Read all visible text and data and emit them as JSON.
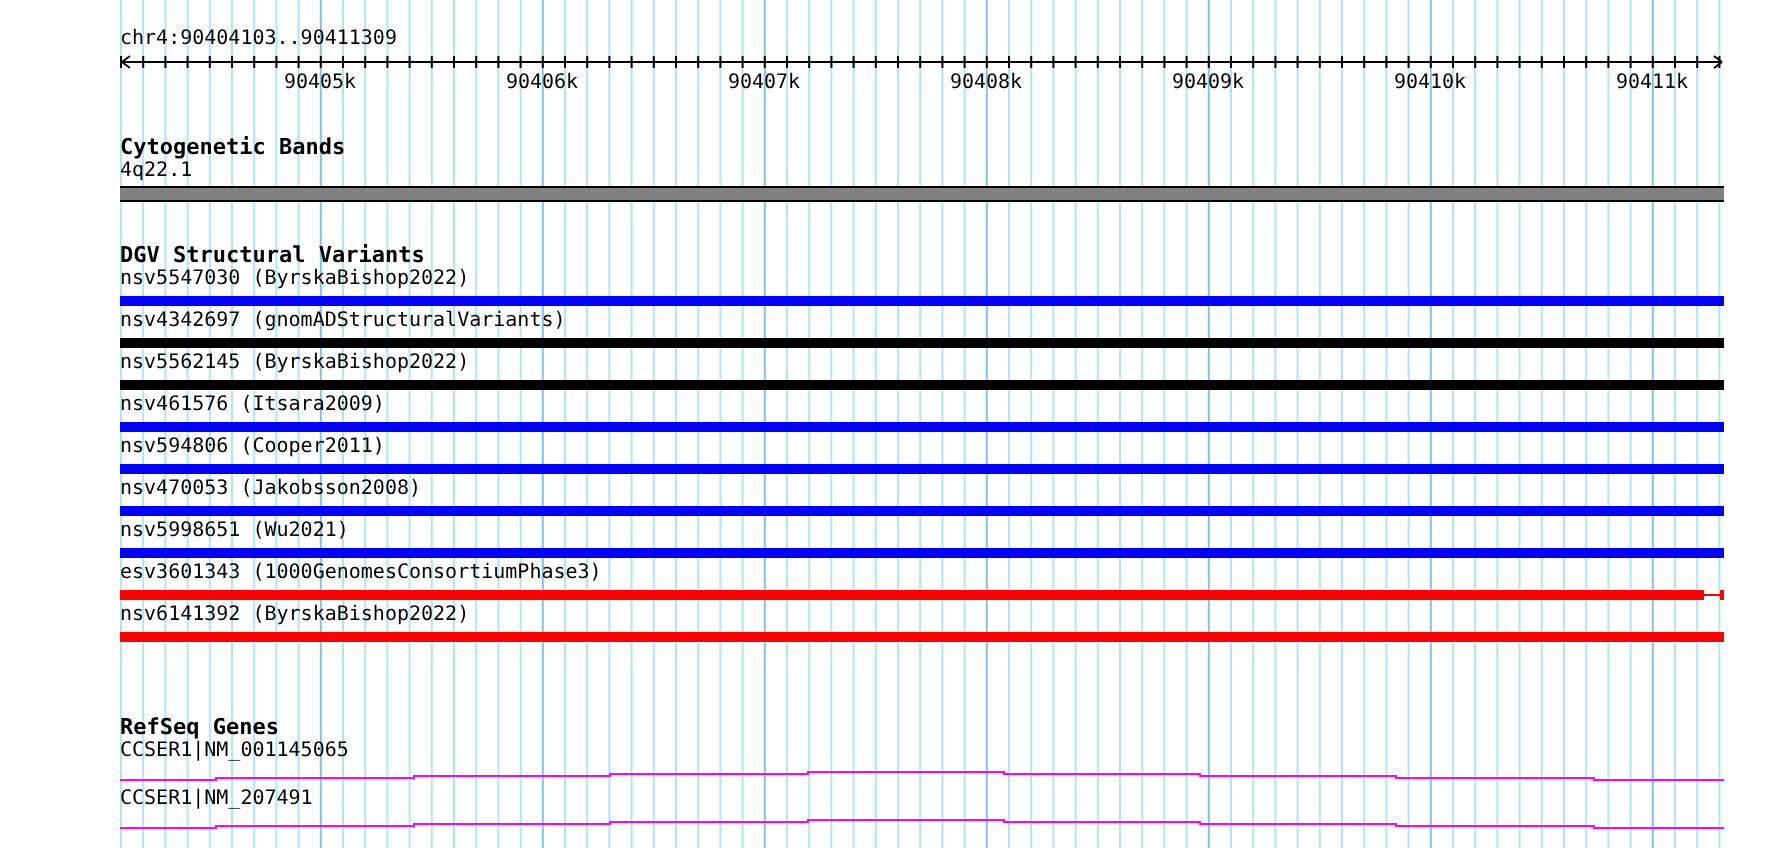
{
  "ruler": {
    "range": "chr4:90404103..90411309",
    "tick_labels": [
      "90405k",
      "90406k",
      "90407k",
      "90408k",
      "90409k",
      "90410k",
      "90411k"
    ]
  },
  "cytogenetic_bands": {
    "title": "Cytogenetic Bands",
    "band": "4q22.1"
  },
  "dgv_structural_variants": {
    "title": "DGV Structural Variants",
    "variants": [
      {
        "label": "nsv5547030 (ByrskaBishop2022)",
        "color": "#0000ff",
        "kind": "full"
      },
      {
        "label": "nsv4342697 (gnomADStructuralVariants)",
        "color": "#000000",
        "kind": "full"
      },
      {
        "label": "nsv5562145 (ByrskaBishop2022)",
        "color": "#000000",
        "kind": "full"
      },
      {
        "label": "nsv461576 (Itsara2009)",
        "color": "#0000ff",
        "kind": "full"
      },
      {
        "label": "nsv594806 (Cooper2011)",
        "color": "#0000ff",
        "kind": "full"
      },
      {
        "label": "nsv470053 (Jakobsson2008)",
        "color": "#0000ff",
        "kind": "full"
      },
      {
        "label": "nsv5998651 (Wu2021)",
        "color": "#0000ff",
        "kind": "full"
      },
      {
        "label": "esv3601343 (1000GenomesConsortiumPhase3)",
        "color": "#ff0000",
        "kind": "thin-end"
      },
      {
        "label": "nsv6141392 (ByrskaBishop2022)",
        "color": "#ff0000",
        "kind": "full"
      }
    ]
  },
  "refseq_genes": {
    "title": "RefSeq Genes",
    "genes": [
      {
        "label": "CCSER1|NM_001145065"
      },
      {
        "label": "CCSER1|NM_207491"
      }
    ]
  }
}
